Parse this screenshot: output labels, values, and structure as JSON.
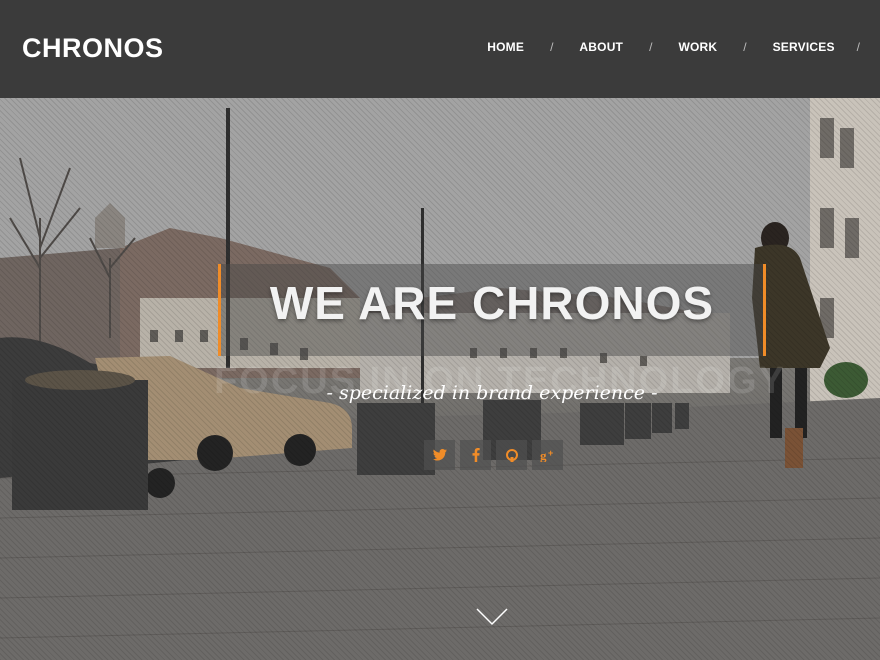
{
  "header": {
    "logo": "CHRONOS",
    "nav": [
      {
        "label": "HOME"
      },
      {
        "label": "ABOUT"
      },
      {
        "label": "WORK"
      },
      {
        "label": "SERVICES"
      }
    ],
    "separator": "/"
  },
  "hero": {
    "title": "WE ARE CHRONOS",
    "tagline": "- specialized in brand experience -",
    "background_text": "FOCUS IN ON TECHNOLOGY",
    "accent_color": "#f08c28",
    "social": [
      {
        "icon": "twitter-icon"
      },
      {
        "icon": "facebook-icon"
      },
      {
        "icon": "github-icon"
      },
      {
        "icon": "google-plus-icon"
      }
    ],
    "scroll_icon": "chevron-down-icon"
  }
}
